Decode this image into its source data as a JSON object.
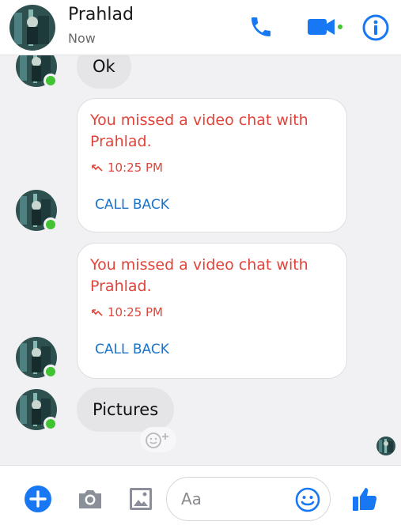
{
  "colors": {
    "accent": "#1a73c9",
    "missed_call": "#e0443a",
    "online": "#43c234",
    "header_icon": "#1877f2"
  },
  "header": {
    "contact_name": "Prahlad",
    "status": "Now",
    "icons": [
      "back-avatar",
      "phone-icon",
      "video-icon",
      "info-icon"
    ]
  },
  "messages": [
    {
      "type": "text",
      "text": "Ok"
    },
    {
      "type": "missed_video_chat",
      "text": "You missed a video chat with Prahlad.",
      "time": "10:25 PM",
      "action": "CALL BACK"
    },
    {
      "type": "missed_video_chat",
      "text": "You missed a video chat with Prahlad.",
      "time": "10:25 PM",
      "action": "CALL BACK"
    },
    {
      "type": "text",
      "text": "Pictures"
    }
  ],
  "composer": {
    "placeholder": "Aa",
    "icons": [
      "plus-icon",
      "camera-icon",
      "gallery-icon",
      "emoji-icon",
      "thumbs-up-icon"
    ]
  }
}
